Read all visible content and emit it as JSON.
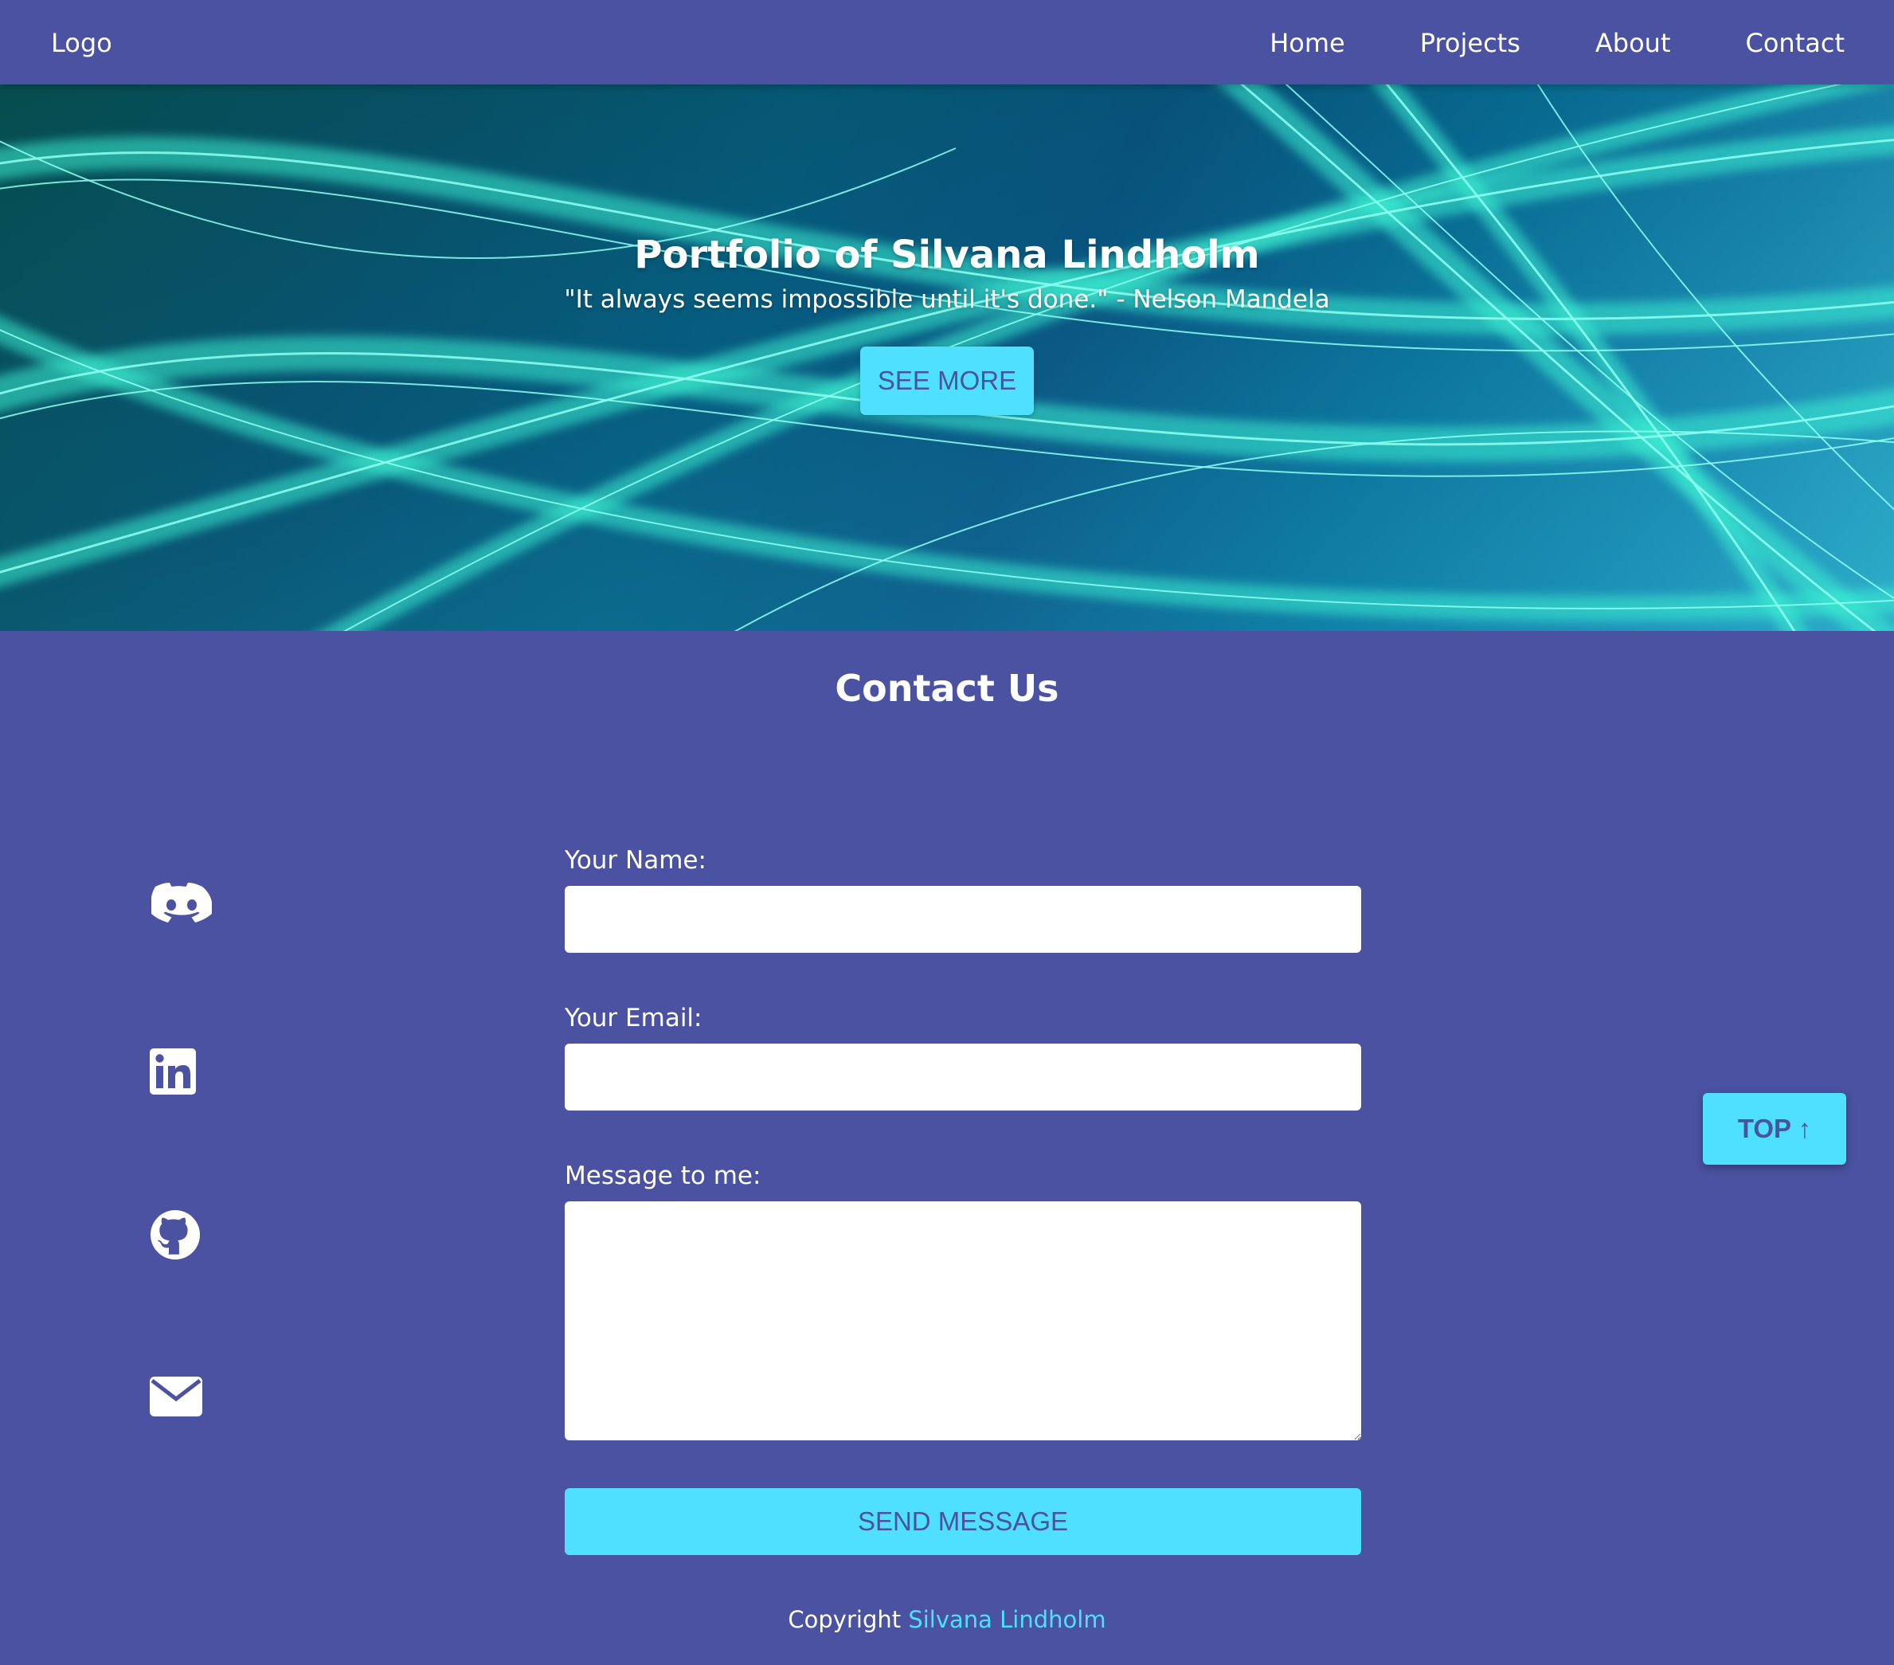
{
  "navbar": {
    "logo": "Logo",
    "links": [
      "Home",
      "Projects",
      "About",
      "Contact"
    ]
  },
  "hero": {
    "title": "Portfolio of Silvana Lindholm",
    "quote": "\"It always seems impossible until it's done.\" - Nelson Mandela",
    "button_label": "SEE MORE"
  },
  "contact": {
    "title": "Contact Us",
    "name_label": "Your Name:",
    "name_value": "",
    "email_label": "Your Email:",
    "email_value": "",
    "message_label": "Message to me:",
    "message_value": "",
    "send_label": "SEND MESSAGE"
  },
  "social": {
    "icons": [
      "discord-icon",
      "linkedin-icon",
      "github-icon",
      "envelope-icon"
    ]
  },
  "footer": {
    "prefix": "Copyright",
    "name": "Silvana Lindholm"
  },
  "top_button": {
    "label": "TOP ↑"
  },
  "colors": {
    "background": "#4a52a1",
    "accent": "#4fe0ff",
    "text": "#ffffff"
  }
}
